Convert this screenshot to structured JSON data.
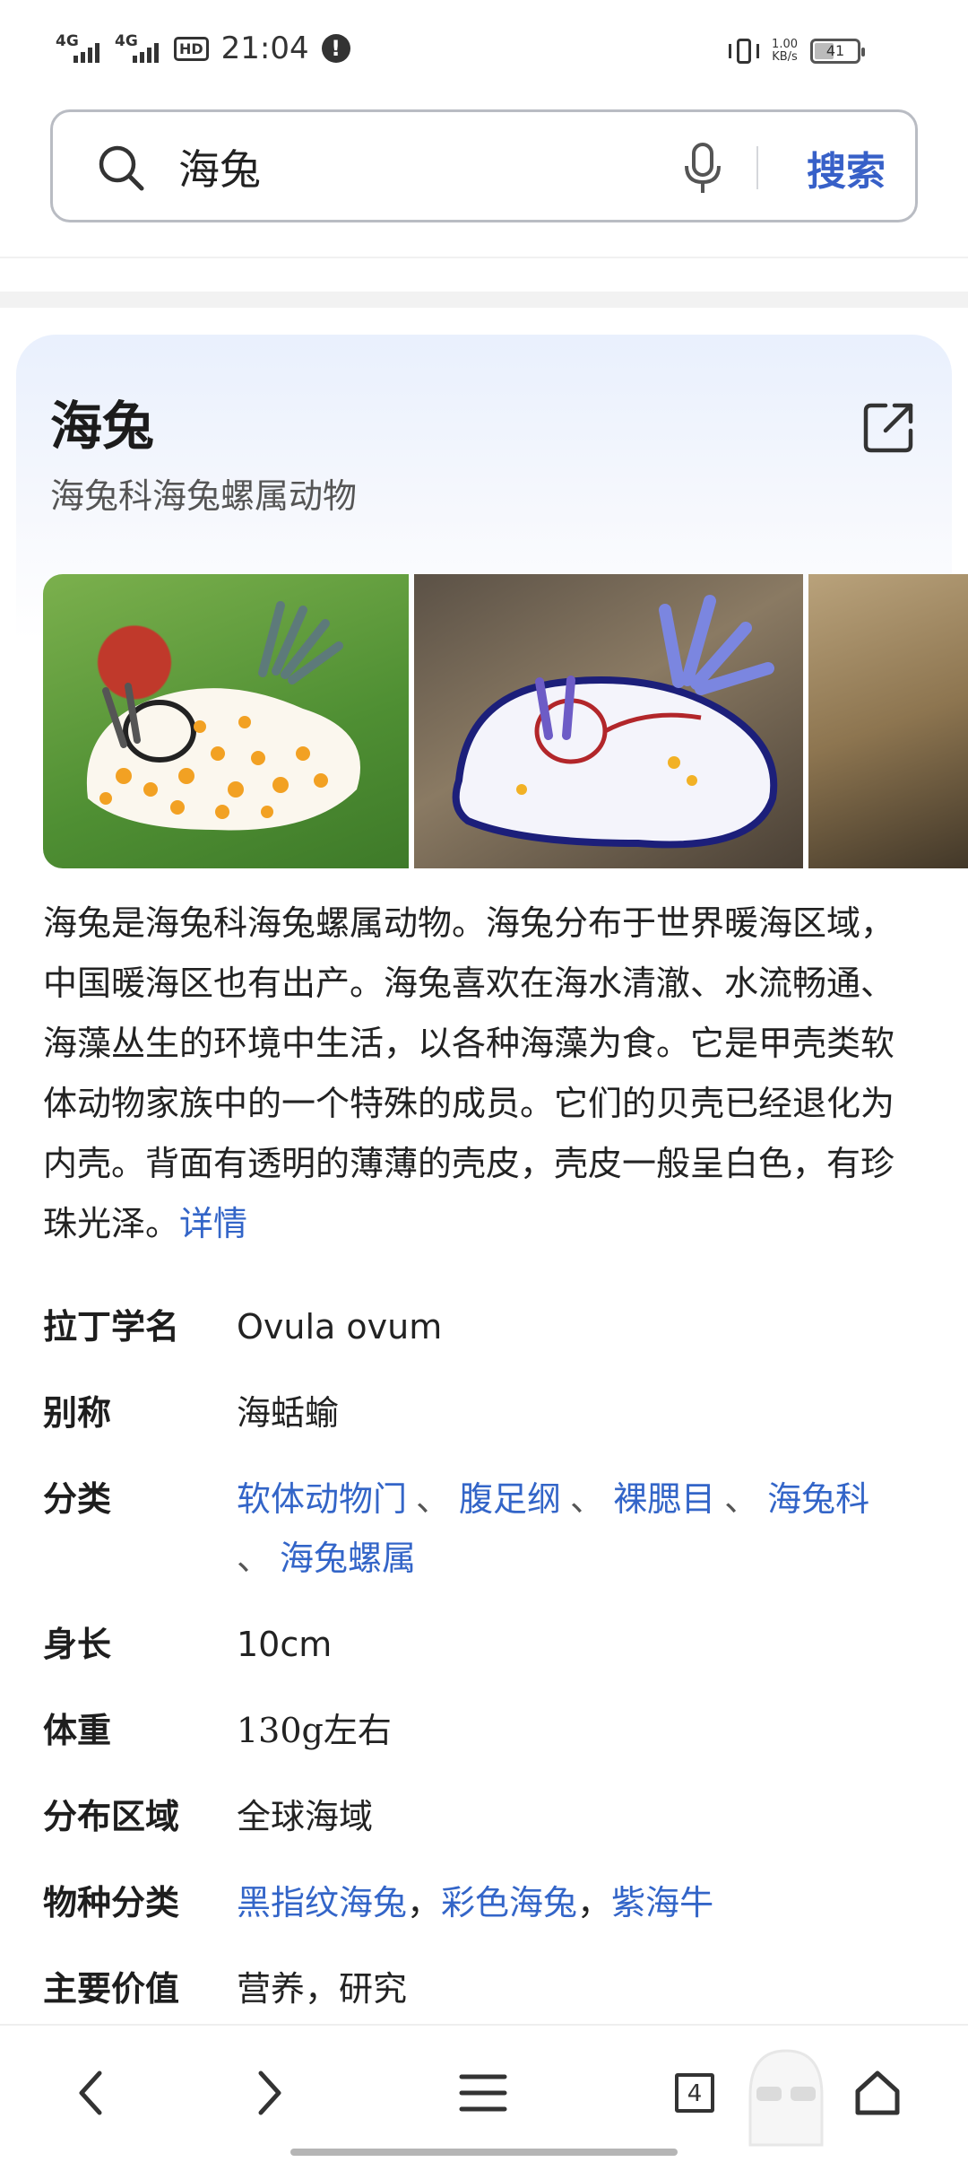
{
  "status_bar": {
    "network_1": "4G",
    "network_2": "4G",
    "hd": "HD",
    "time": "21:04",
    "alert": "!",
    "net_speed_value": "1.00",
    "net_speed_unit": "KB/s",
    "battery_level": "41"
  },
  "search": {
    "query": "海兔",
    "button_label": "搜索",
    "icon": "search-icon",
    "mic_icon": "mic-icon"
  },
  "entry": {
    "title": "海兔",
    "subtitle": "海兔科海兔螺属动物",
    "share_icon": "external-link-icon",
    "description": "海兔是海兔科海兔螺属动物。海兔分布于世界暖海区域，中国暖海区也有出产。海兔喜欢在海水清澈、水流畅通、海藻丛生的环境中生活，以各种海藻为食。它是甲壳类软体动物家族中的一个特殊的成员。它们的贝壳已经退化为内壳。背面有透明的薄薄的壳皮，壳皮一般呈白色，有珍珠光泽。",
    "more_link": "详情"
  },
  "info": {
    "latin_label": "拉丁学名",
    "latin_value": "Ovula ovum",
    "alias_label": "别称",
    "alias_value": "海蛞蝓",
    "class_label": "分类",
    "class_values": [
      "软体动物门",
      "腹足纲",
      "裸腮目",
      "海兔科",
      "海兔螺属"
    ],
    "class_sep": "、",
    "length_label": "身长",
    "length_value": "10cm",
    "weight_label": "体重",
    "weight_value": "130g左右",
    "region_label": "分布区域",
    "region_value": "全球海域",
    "species_label": "物种分类",
    "species_values": [
      "黑指纹海兔",
      "彩色海兔",
      "紫海牛"
    ],
    "species_sep": "，",
    "value_label": "主要价值",
    "value_value": "营养，研究"
  },
  "bottom_nav": {
    "tabs_count": "4",
    "icons": [
      "back-icon",
      "forward-icon",
      "menu-icon",
      "tabs-icon",
      "home-icon"
    ]
  },
  "colors": {
    "link": "#3365c8",
    "search_button": "#3760c8"
  }
}
